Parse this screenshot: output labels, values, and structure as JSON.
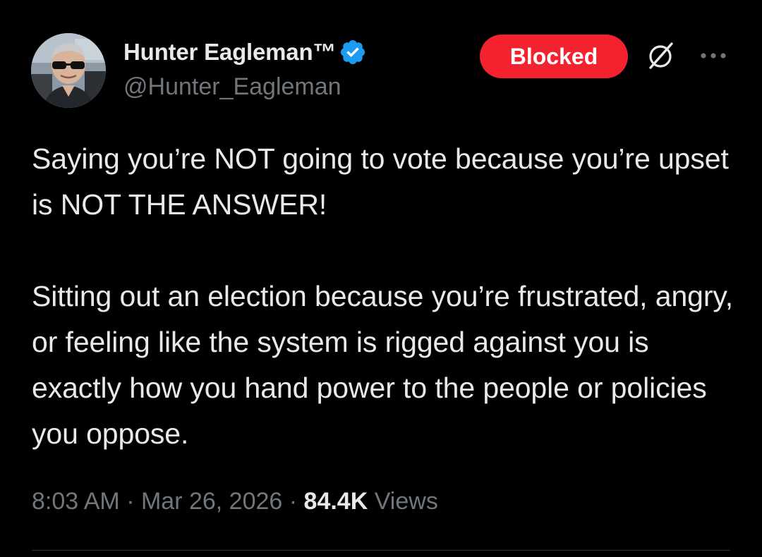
{
  "author": {
    "display_name": "Hunter Eagleman™",
    "handle": "@Hunter_Eagleman",
    "verified_icon": "verified-badge-icon",
    "verified_color": "#1d9bf0"
  },
  "actions": {
    "blocked_label": "Blocked",
    "blocked_color": "#f4212e",
    "grok_icon": "grok-icon",
    "more_icon": "more-options-icon"
  },
  "tweet": {
    "paragraphs": [
      "Saying you’re NOT going to vote because you’re upset is NOT THE ANSWER!",
      "Sitting out an election because you’re frustrated, angry, or feeling like the system is rigged against you is exactly how you hand power to the people or policies you oppose."
    ]
  },
  "meta": {
    "time": "8:03 AM",
    "separator": " · ",
    "date": "Mar 26, 2026",
    "views_count": "84.4K",
    "views_label": "Views"
  }
}
